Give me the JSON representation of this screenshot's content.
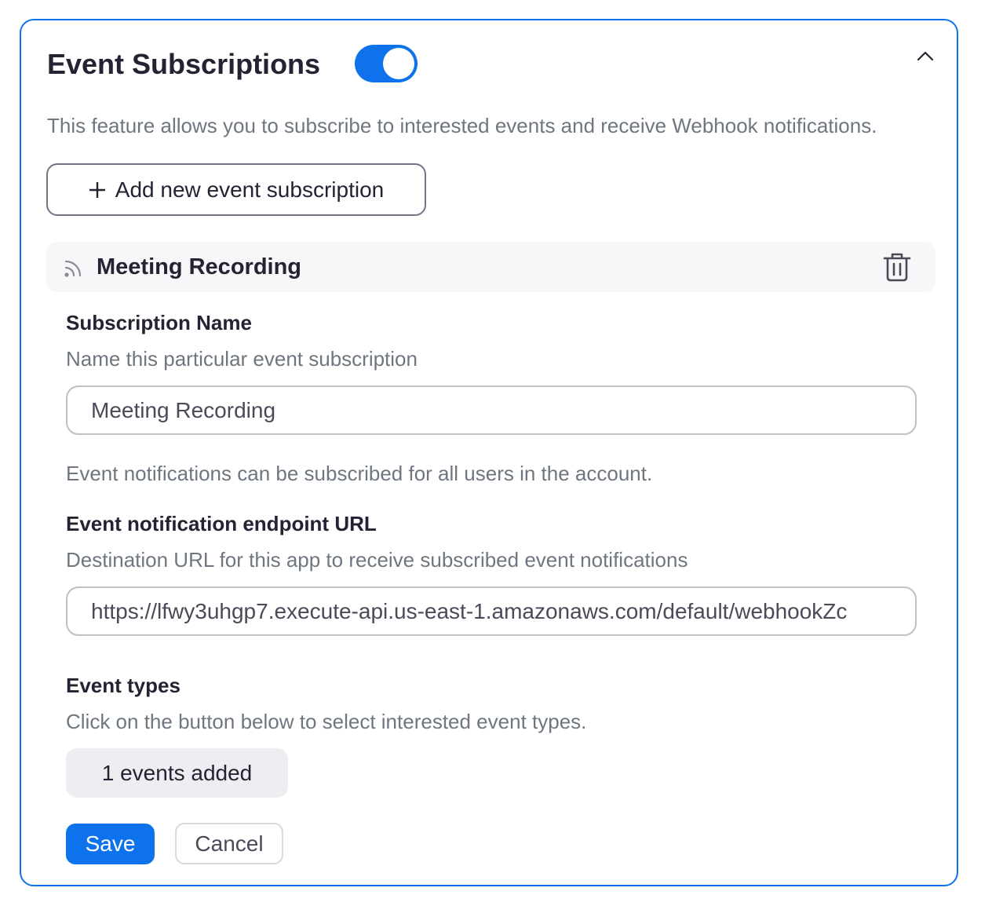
{
  "section": {
    "title": "Event Subscriptions",
    "enabled": true,
    "description": "This feature allows you to subscribe to interested events and receive Webhook notifications."
  },
  "add_button": {
    "icon": "plus-icon",
    "label": "Add new event subscription"
  },
  "subscription": {
    "header_icon": "rss-icon",
    "header_title": "Meeting Recording",
    "delete_icon": "trash-icon",
    "name_label": "Subscription Name",
    "name_help": "Name this particular event subscription",
    "name_value": "Meeting Recording",
    "scope_note": "Event notifications can be subscribed for all users in the account.",
    "url_label": "Event notification endpoint URL",
    "url_help": "Destination URL for this app to receive subscribed event notifications",
    "url_value": "https://lfwy3uhgp7.execute-api.us-east-1.amazonaws.com/default/webhookZc",
    "types_label": "Event types",
    "types_help": "Click on the button below to select interested event types.",
    "events_button": "1 events added"
  },
  "actions": {
    "save_label": "Save",
    "cancel_label": "Cancel"
  },
  "colors": {
    "accent": "#0e72ed",
    "muted_text": "#6e7680",
    "header_bg": "#f6f7f9"
  }
}
